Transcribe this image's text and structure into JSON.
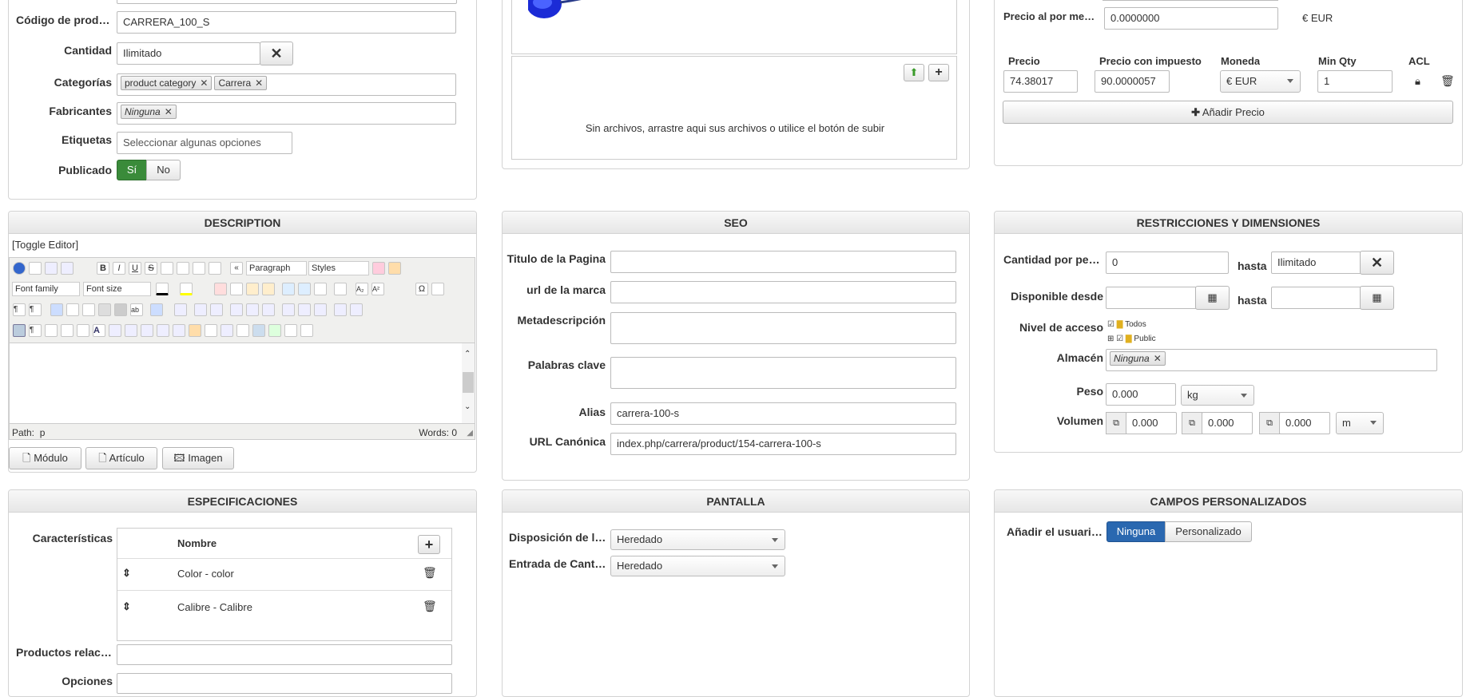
{
  "general": {
    "codigo_label": "Código de produ…",
    "codigo_value": "CARRERA_100_S",
    "cantidad_label": "Cantidad",
    "cantidad_value": "Ilimitado",
    "categorias_label": "Categorías",
    "categorias": [
      "product category",
      "Carrera"
    ],
    "fabricantes_label": "Fabricantes",
    "fabricantes": [
      "Ninguna"
    ],
    "etiquetas_label": "Etiquetas",
    "etiquetas_placeholder": "Seleccionar algunas opciones",
    "publicado_label": "Publicado",
    "si_label": "Sí",
    "no_label": "No"
  },
  "media": {
    "dropzone_text": "Sin archivos, arrastre aqui sus archivos o utilice el botón de subir"
  },
  "prices": {
    "wholesale_label": "Precio al por me…",
    "wholesale_value": "0.0000000",
    "wholesale_currency": "€ EUR",
    "col_precio": "Precio",
    "col_impuesto": "Precio con impuesto",
    "col_moneda": "Moneda",
    "col_minqty": "Min Qty",
    "col_acl": "ACL",
    "precio": "74.38017",
    "impuesto": "90.0000057",
    "moneda": "€ EUR",
    "minqty": "1",
    "add_price": "Añadir Precio"
  },
  "description": {
    "title": "DESCRIPTION",
    "toggle": "[Toggle Editor]",
    "format": "Paragraph",
    "styles": "Styles",
    "font_family": "Font family",
    "font_size": "Font size",
    "path_label": "Path:",
    "path_value": "p",
    "words": "Words: 0",
    "btn_modulo": "Módulo",
    "btn_articulo": "Artículo",
    "btn_imagen": "Imagen"
  },
  "seo": {
    "title": "SEO",
    "titulo_label": "Titulo de la Pagina",
    "url_marca_label": "url de la marca",
    "meta_label": "Metadescripción",
    "palabras_label": "Palabras clave",
    "alias_label": "Alias",
    "alias_value": "carrera-100-s",
    "canonica_label": "URL Canónica",
    "canonica_value": "index.php/carrera/product/154-carrera-100-s"
  },
  "restricciones": {
    "title": "RESTRICCIONES Y DIMENSIONES",
    "cantidad_label": "Cantidad por ped…",
    "cantidad_value": "0",
    "hasta": "hasta",
    "hasta_value": "Ilimitado",
    "disponible_label": "Disponible desde",
    "nivel_label": "Nivel de acceso",
    "tree_todos": "Todos",
    "tree_public": "Public",
    "almacen_label": "Almacén",
    "almacen_tag": "Ninguna",
    "peso_label": "Peso",
    "peso_value": "0.000",
    "peso_unit": "kg",
    "volumen_label": "Volumen",
    "vol1": "0.000",
    "vol2": "0.000",
    "vol3": "0.000",
    "vol_unit": "m"
  },
  "specs": {
    "title": "ESPECIFICACIONES",
    "caracteristicas_label": "Características",
    "col_nombre": "Nombre",
    "rows": [
      "Color - color",
      "Calibre - Calibre"
    ],
    "relacionados_label": "Productos relaci…",
    "opciones_label": "Opciones"
  },
  "pantalla": {
    "title": "PANTALLA",
    "disposicion_label": "Disposición de la…",
    "disposicion_value": "Heredado",
    "entrada_label": "Entrada de Canti…",
    "entrada_value": "Heredado"
  },
  "campos": {
    "title": "CAMPOS PERSONALIZADOS",
    "label": "Añadir el usuario…",
    "ninguna": "Ninguna",
    "personalizado": "Personalizado"
  }
}
